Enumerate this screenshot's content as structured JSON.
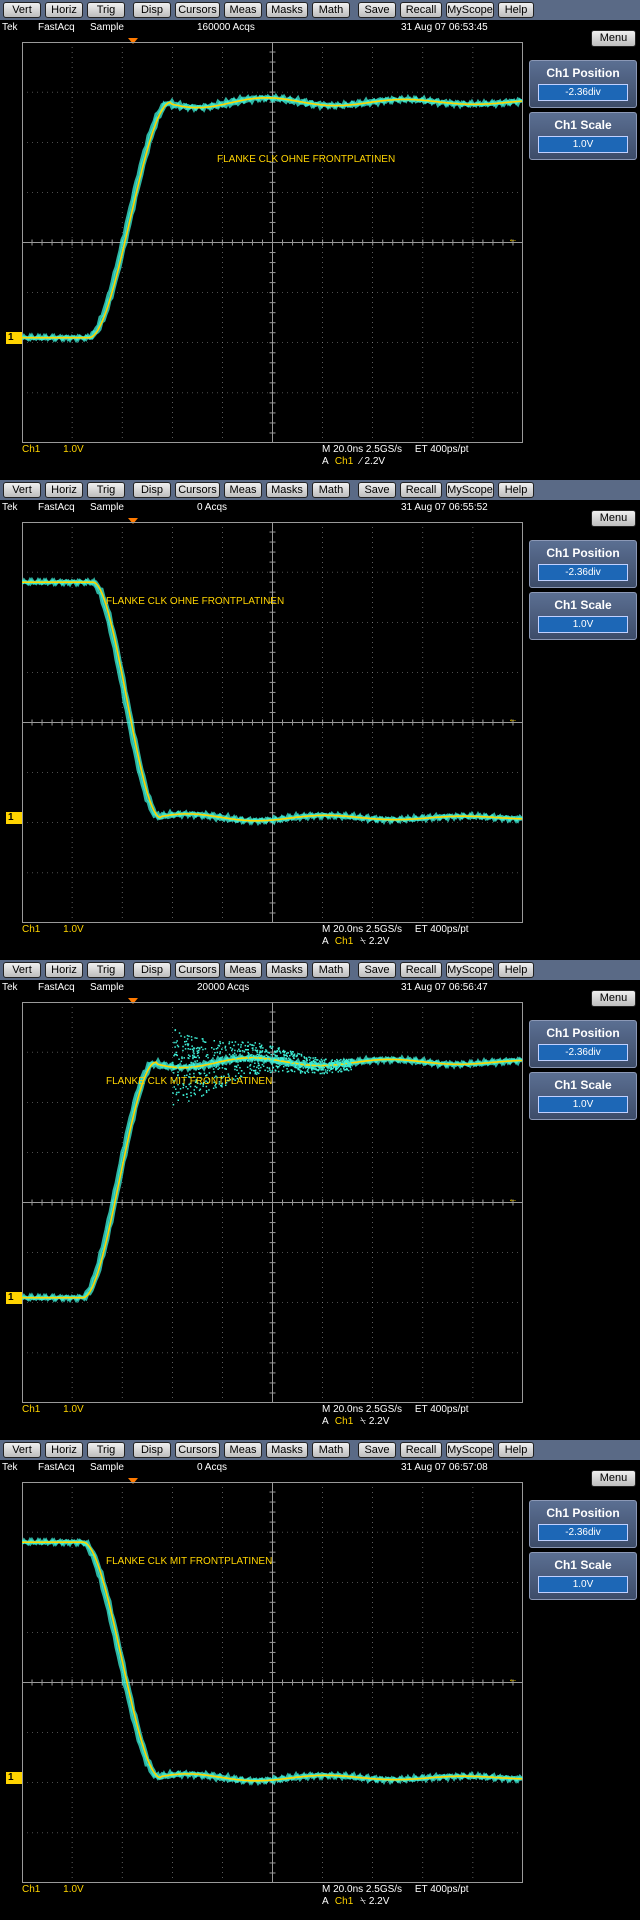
{
  "menu": [
    "Vert",
    "Horiz",
    "Trig",
    "Disp",
    "Cursors",
    "Meas",
    "Masks",
    "Math",
    "Save",
    "Recall",
    "MyScope",
    "Help"
  ],
  "menu_button": "Menu",
  "ch1_marker": "1",
  "trigger_arrow": "←",
  "panels": [
    {
      "brand": "Tek",
      "mode": "FastAcq",
      "acq_type": "Sample",
      "acqs": "160000 Acqs",
      "timestamp": "31 Aug 07 06:53:45",
      "annotation": "FLANKE CLK OHNE FRONTPLATINEN",
      "ch": "Ch1",
      "scale": "1.0V",
      "timebase": "M 20.0ns 2.5GS/s",
      "et": "ET 400ps/pt",
      "trig_prefix": "A",
      "trig_ch": "Ch1",
      "trig_text": "⁄ 2.2V",
      "ctrl1_title": "Ch1 Position",
      "ctrl1_value": "-2.36div",
      "ctrl2_title": "Ch1 Scale",
      "ctrl2_value": "1.0V",
      "edge": "rising",
      "noise": "low"
    },
    {
      "brand": "Tek",
      "mode": "FastAcq",
      "acq_type": "Sample",
      "acqs": "0 Acqs",
      "timestamp": "31 Aug 07 06:55:52",
      "annotation": "FLANKE CLK OHNE FRONTPLATINEN",
      "ch": "Ch1",
      "scale": "1.0V",
      "timebase": "M 20.0ns 2.5GS/s",
      "et": "ET 400ps/pt",
      "trig_prefix": "A",
      "trig_ch": "Ch1",
      "trig_text": "⍀ 2.2V",
      "ctrl1_title": "Ch1 Position",
      "ctrl1_value": "-2.36div",
      "ctrl2_title": "Ch1 Scale",
      "ctrl2_value": "1.0V",
      "edge": "falling",
      "noise": "low"
    },
    {
      "brand": "Tek",
      "mode": "FastAcq",
      "acq_type": "Sample",
      "acqs": "20000 Acqs",
      "timestamp": "31 Aug 07 06:56:47",
      "annotation": "FLANKE CLK MIT FRONTPLATINEN",
      "ch": "Ch1",
      "scale": "1.0V",
      "timebase": "M 20.0ns 2.5GS/s",
      "et": "ET 400ps/pt",
      "trig_prefix": "A",
      "trig_ch": "Ch1",
      "trig_text": "⍀ 2.2V",
      "ctrl1_title": "Ch1 Position",
      "ctrl1_value": "-2.36div",
      "ctrl2_title": "Ch1 Scale",
      "ctrl2_value": "1.0V",
      "edge": "rising",
      "noise": "high"
    },
    {
      "brand": "Tek",
      "mode": "FastAcq",
      "acq_type": "Sample",
      "acqs": "0 Acqs",
      "timestamp": "31 Aug 07 06:57:08",
      "annotation": "FLANKE CLK MIT FRONTPLATINEN",
      "ch": "Ch1",
      "scale": "1.0V",
      "timebase": "M 20.0ns 2.5GS/s",
      "et": "ET 400ps/pt",
      "trig_prefix": "A",
      "trig_ch": "Ch1",
      "trig_text": "⍀ 2.2V",
      "ctrl1_title": "Ch1 Position",
      "ctrl1_value": "-2.36div",
      "ctrl2_title": "Ch1 Scale",
      "ctrl2_value": "1.0V",
      "edge": "falling",
      "noise": "medium"
    }
  ],
  "colors": {
    "trace_core": "#ffd400",
    "trace_halo": "#3ef0d8",
    "grid": "#9a9a9a",
    "panel_bg": "#000000",
    "menubar": "#5a6a86"
  }
}
